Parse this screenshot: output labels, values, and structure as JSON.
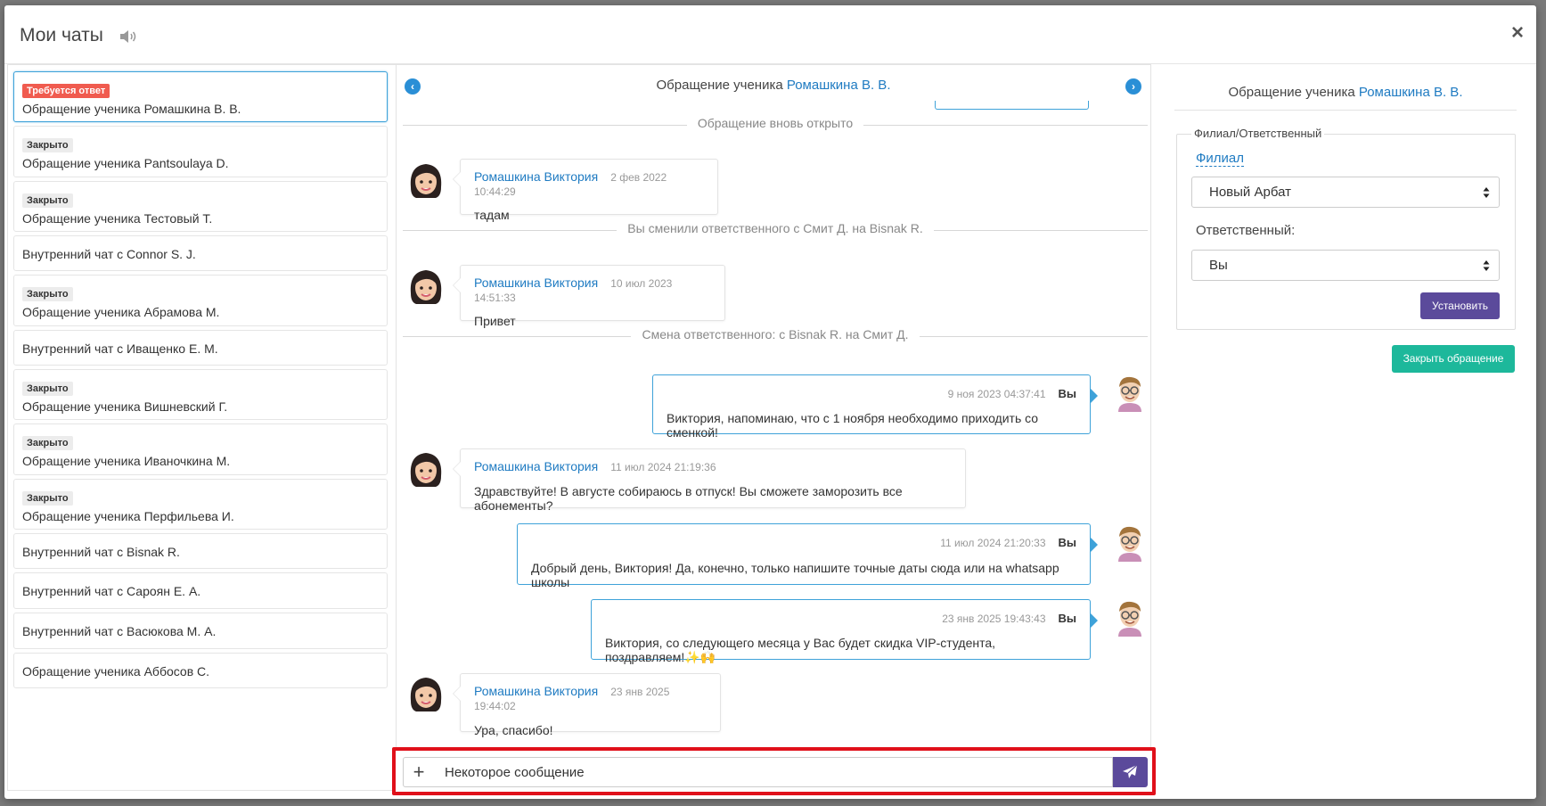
{
  "modal": {
    "title": "Мои чаты"
  },
  "chat_list": [
    {
      "badge": "Требуется ответ",
      "badge_type": "need-reply",
      "title": "Обращение ученика Ромашкина В. В.",
      "active": true
    },
    {
      "badge": "Закрыто",
      "badge_type": "closed",
      "title": "Обращение ученика Pantsoulaya D."
    },
    {
      "badge": "Закрыто",
      "badge_type": "closed",
      "title": "Обращение ученика Тестовый Т."
    },
    {
      "badge": "",
      "title": "Внутренний чат с Connor S. J."
    },
    {
      "badge": "Закрыто",
      "badge_type": "closed",
      "title": "Обращение ученика Абрамова М."
    },
    {
      "badge": "",
      "title": "Внутренний чат с Иващенко Е. М."
    },
    {
      "badge": "Закрыто",
      "badge_type": "closed",
      "title": "Обращение ученика Вишневский Г."
    },
    {
      "badge": "Закрыто",
      "badge_type": "closed",
      "title": "Обращение ученика Иваночкина М."
    },
    {
      "badge": "Закрыто",
      "badge_type": "closed",
      "title": "Обращение ученика Перфильева И."
    },
    {
      "badge": "",
      "title": "Внутренний чат с Bisnak R."
    },
    {
      "badge": "",
      "title": "Внутренний чат с Сароян Е. А."
    },
    {
      "badge": "",
      "title": "Внутренний чат с Васюкова М. А."
    },
    {
      "badge": "",
      "title": "Обращение ученика Аббосов С."
    }
  ],
  "conversation": {
    "header_prefix": "Обращение ученика",
    "header_student": "Ромашкина В. В.",
    "dividers": [
      "Обращение вновь открыто",
      "Вы сменили ответственного с Смит Д. на Bisnak R.",
      "Смена ответственного: с Bisnak R. на Смит Д."
    ],
    "messages": [
      {
        "sender": "Ромашкина Виктория",
        "time": "2 фев 2022 10:44:29",
        "text": "тадам"
      },
      {
        "sender": "Ромашкина Виктория",
        "time": "10 июл 2023 14:51:33",
        "text": "Привет"
      },
      {
        "sender": "Вы",
        "time": "9 ноя 2023 04:37:41",
        "text": "Виктория, напоминаю, что с 1 ноября необходимо приходить со сменкой!"
      },
      {
        "sender": "Ромашкина Виктория",
        "time": "11 июл 2024 21:19:36",
        "text": "Здравствуйте! В августе собираюсь в отпуск! Вы сможете заморозить все абонементы?"
      },
      {
        "sender": "Вы",
        "time": "11 июл 2024 21:20:33",
        "text": "Добрый день, Виктория! Да, конечно, только напишите точные даты сюда или на whatsapp школы"
      },
      {
        "sender": "Вы",
        "time": "23 янв 2025 19:43:43",
        "text": "Виктория, со следующего месяца у Вас будет скидка VIP-студента, поздравляем!✨🙌"
      },
      {
        "sender": "Ромашкина Виктория",
        "time": "23 янв 2025 19:44:02",
        "text": "Ура, спасибо!"
      }
    ]
  },
  "composer": {
    "value": "Некоторое сообщение"
  },
  "side_panel": {
    "title_prefix": "Обращение ученика",
    "title_student": "Ромашкина В. В.",
    "legend": "Филиал/Ответственный",
    "branch_link": "Филиал",
    "branch_value": "Новый Арбат",
    "responsible_label": "Ответственный:",
    "responsible_value": "Вы",
    "set_button": "Установить",
    "close_request_button": "Закрыть обращение"
  },
  "colors": {
    "accent": "#1f7bc2",
    "brand_button": "#5b4a9b",
    "close_button": "#1db89b",
    "need_reply_badge": "#f05b4f",
    "highlight_frame": "#e0101a"
  }
}
